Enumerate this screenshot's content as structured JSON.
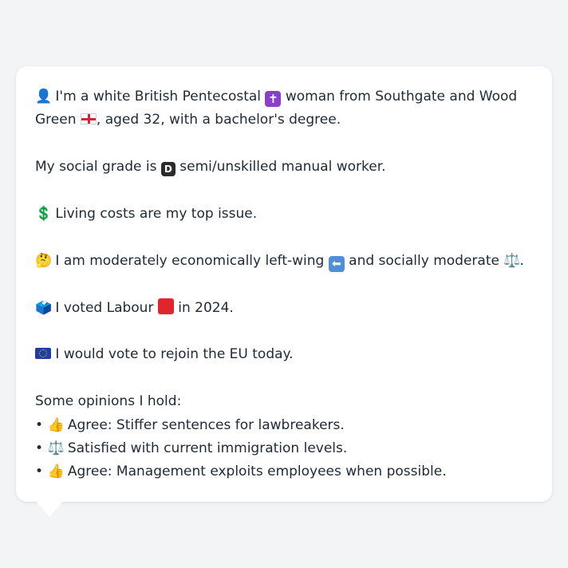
{
  "profile": {
    "intro_a": "I'm a white British Pentecostal",
    "intro_b": "woman from Southgate and Wood",
    "intro_c": "Green",
    "intro_d": ", aged 32, with a bachelor's degree.",
    "grade_a": "My social grade is",
    "grade_b": "semi/unskilled manual worker.",
    "top_issue": "Living costs are my top issue.",
    "stance_a": "I am moderately economically left-wing",
    "stance_b": "and socially moderate",
    "stance_c": ".",
    "vote_a": "I voted Labour",
    "vote_b": "in 2024.",
    "eu": "I would vote to rejoin the EU today.",
    "opinions_title": "Some opinions I hold:",
    "opinions": [
      {
        "bullet": "•",
        "icon": "thumbs-up-icon",
        "glyph": "👍",
        "text": "Agree: Stiffer sentences for lawbreakers."
      },
      {
        "bullet": "•",
        "icon": "balance-scale-icon",
        "glyph": "⚖️",
        "text": "Satisfied with current immigration levels."
      },
      {
        "bullet": "•",
        "icon": "thumbs-up-icon",
        "glyph": "👍",
        "text": "Agree: Management exploits employees when possible."
      }
    ]
  },
  "icons": {
    "person": "👤",
    "cross": "✝",
    "d_letter": "D",
    "dollar": "💲",
    "thinking": "🤔",
    "left_arrow": "⬅",
    "scale": "⚖️",
    "ballot": "🗳️"
  },
  "colors": {
    "background": "#f3f4f6",
    "card": "#ffffff",
    "text": "#1f2937"
  }
}
